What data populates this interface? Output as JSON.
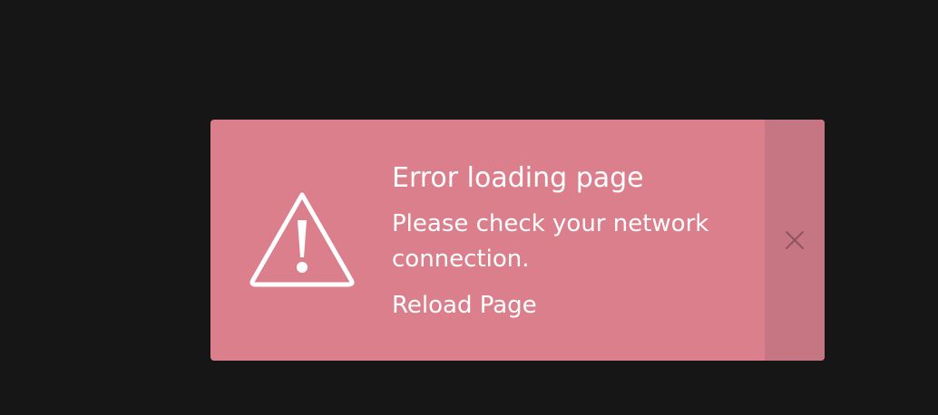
{
  "toast": {
    "title": "Error loading page",
    "message": "Please check your network connection.",
    "action_label": "Reload Page",
    "warning_icon": "warning-triangle-icon",
    "close_icon": "close-icon"
  },
  "colors": {
    "page_background": "#161616",
    "toast_background": "#db7f8d",
    "close_area_background": "#c67683",
    "text": "#ffffff",
    "close_icon": "#8d5660"
  }
}
